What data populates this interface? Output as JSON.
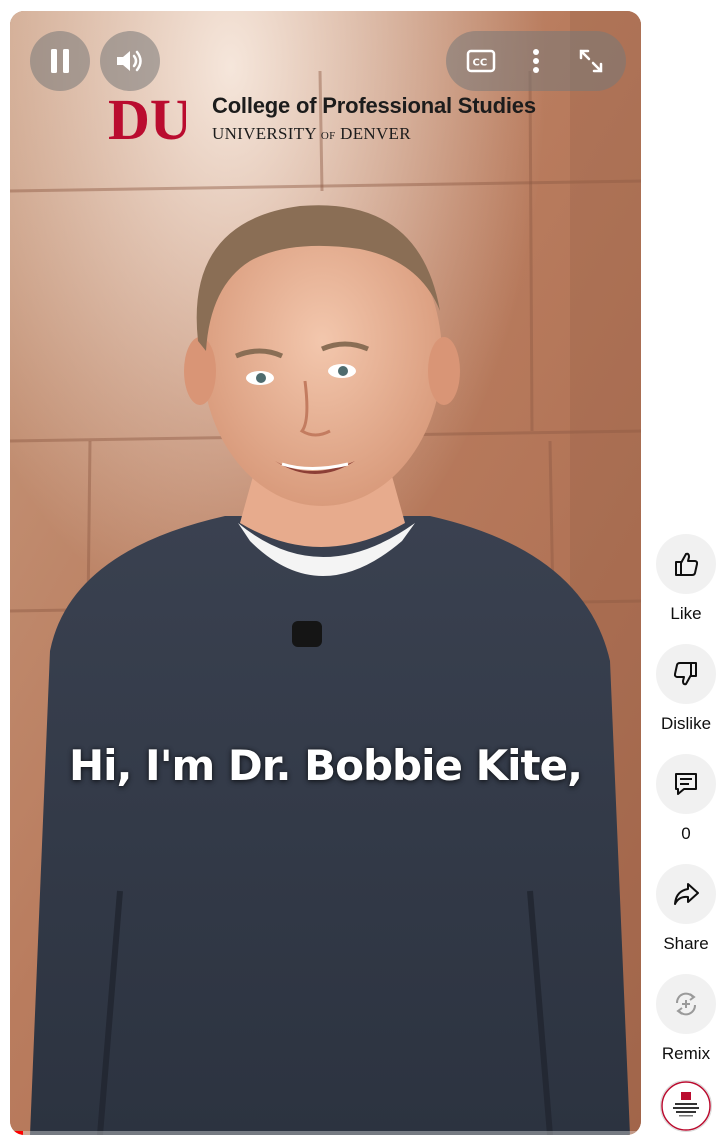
{
  "player": {
    "caption": "Hi, I'm Dr. Bobbie Kite,",
    "progress": 0.02,
    "controls": {
      "play_pause_icon": "pause-icon",
      "volume_icon": "volume-icon",
      "captions_icon": "closed-captions-icon",
      "more_icon": "more-vertical-icon",
      "fullscreen_icon": "fullscreen-icon"
    }
  },
  "brand": {
    "title": "College of Professional Studies",
    "sub_prefix": "UNIVERSITY ",
    "sub_of": "OF",
    "sub_suffix": " DENVER",
    "logo_letters": "DU",
    "color": "#ba0c2f"
  },
  "actions": [
    {
      "label": "Like",
      "icon": "thumbs-up-icon"
    },
    {
      "label": "Dislike",
      "icon": "thumbs-down-icon"
    },
    {
      "label": "0",
      "icon": "comment-icon"
    },
    {
      "label": "Share",
      "icon": "share-icon"
    },
    {
      "label": "Remix",
      "icon": "remix-icon"
    }
  ],
  "channel": {
    "avatar": "channel-avatar"
  },
  "colors": {
    "progress": "#ff0000",
    "action_bg": "#f1f1f1",
    "text": "#0f0f0f"
  }
}
